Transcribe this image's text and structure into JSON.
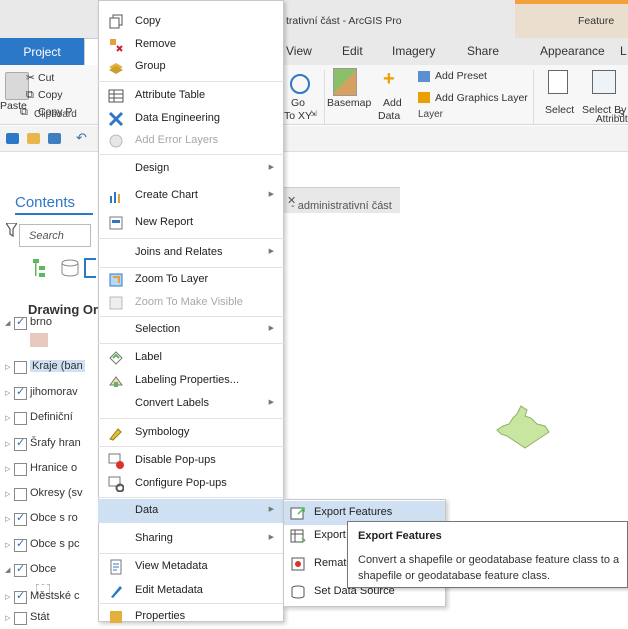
{
  "app": {
    "title": "trativní část - ArcGIS Pro",
    "contextual_tab_header": "Feature"
  },
  "tabs": [
    "Project",
    "View",
    "Edit",
    "Imagery",
    "Share",
    "Appearance",
    "L"
  ],
  "ribbon": {
    "clipboard": {
      "paste": "Paste",
      "cut": "Cut",
      "copy": "Copy",
      "copy_path": "Copy P",
      "group_label": "Clipboard"
    },
    "go_to_xy": {
      "line1": "Go",
      "line2": "To XY"
    },
    "layer": {
      "basemap": "Basemap",
      "add_data_1": "Add",
      "add_data_2": "Data",
      "add_preset": "Add Preset",
      "add_graphics_layer": "Add Graphics Layer",
      "group_label": "Layer"
    },
    "selection": {
      "select": "Select",
      "select_by_1": "Select By",
      "select_by_2": "Attribute",
      "group_label": "S"
    }
  },
  "contents": {
    "title": "Contents",
    "search_placeholder": "Search",
    "drawing_order": "Drawing Ord",
    "layers": [
      {
        "label": "brno",
        "checked": true
      },
      {
        "label": "Kraje (ban",
        "checked": false
      },
      {
        "label": "jihomorav",
        "checked": true
      },
      {
        "label": "Definiční",
        "checked": false
      },
      {
        "label": "Šrafy hran",
        "checked": true
      },
      {
        "label": "Hranice o",
        "checked": false
      },
      {
        "label": "Okresy (sv",
        "checked": false
      },
      {
        "label": "Obce s ro",
        "checked": true
      },
      {
        "label": "Obce s pc",
        "checked": true
      },
      {
        "label": "Obce",
        "checked": true
      },
      {
        "label": "Městské c",
        "checked": true
      },
      {
        "label": "Stát",
        "checked": false
      }
    ]
  },
  "map_view": {
    "tab_label": "- administrativní část"
  },
  "context_menu": {
    "items": [
      {
        "label": "Copy",
        "icon": "copy-icon"
      },
      {
        "label": "Remove",
        "icon": "remove-icon"
      },
      {
        "label": "Group",
        "icon": "group-icon"
      },
      {
        "label": "Attribute Table",
        "icon": "table-icon"
      },
      {
        "label": "Data Engineering",
        "icon": "data-engineering-icon"
      },
      {
        "label": "Add Error Layers",
        "icon": "error-layers-icon",
        "disabled": true
      },
      {
        "label": "Design",
        "submenu": true
      },
      {
        "label": "Create Chart",
        "icon": "chart-icon",
        "submenu": true
      },
      {
        "label": "New Report",
        "icon": "report-icon"
      },
      {
        "label": "Joins and Relates",
        "submenu": true
      },
      {
        "label": "Zoom To Layer",
        "icon": "zoom-icon"
      },
      {
        "label": "Zoom To Make Visible",
        "icon": "zoom-visible-icon",
        "disabled": true
      },
      {
        "label": "Selection",
        "submenu": true
      },
      {
        "label": "Label",
        "icon": "label-icon"
      },
      {
        "label": "Labeling Properties...",
        "icon": "labeling-icon"
      },
      {
        "label": "Convert Labels",
        "submenu": true
      },
      {
        "label": "Symbology",
        "icon": "symbology-icon"
      },
      {
        "label": "Disable Pop-ups",
        "icon": "disable-popups-icon"
      },
      {
        "label": "Configure Pop-ups",
        "icon": "configure-popups-icon"
      },
      {
        "label": "Data",
        "submenu": true,
        "highlighted": true
      },
      {
        "label": "Sharing",
        "submenu": true
      },
      {
        "label": "View Metadata",
        "icon": "metadata-icon"
      },
      {
        "label": "Edit Metadata",
        "icon": "edit-metadata-icon"
      },
      {
        "label": "Properties",
        "icon": "properties-icon"
      }
    ]
  },
  "data_submenu": {
    "items": [
      {
        "label": "Export Features",
        "highlighted": true
      },
      {
        "label": "Export"
      },
      {
        "label": "Remate"
      },
      {
        "label": "Set Data Source"
      }
    ]
  },
  "tooltip": {
    "title": "Export Features",
    "description": "Convert a shapefile or geodatabase feature class to a shapefile or geodatabase feature class."
  },
  "colors": {
    "accent": "#2c78c8",
    "highlight": "#cfe0f2",
    "contextual": "#f5a13b",
    "map_feature": "#c8e6a0"
  }
}
